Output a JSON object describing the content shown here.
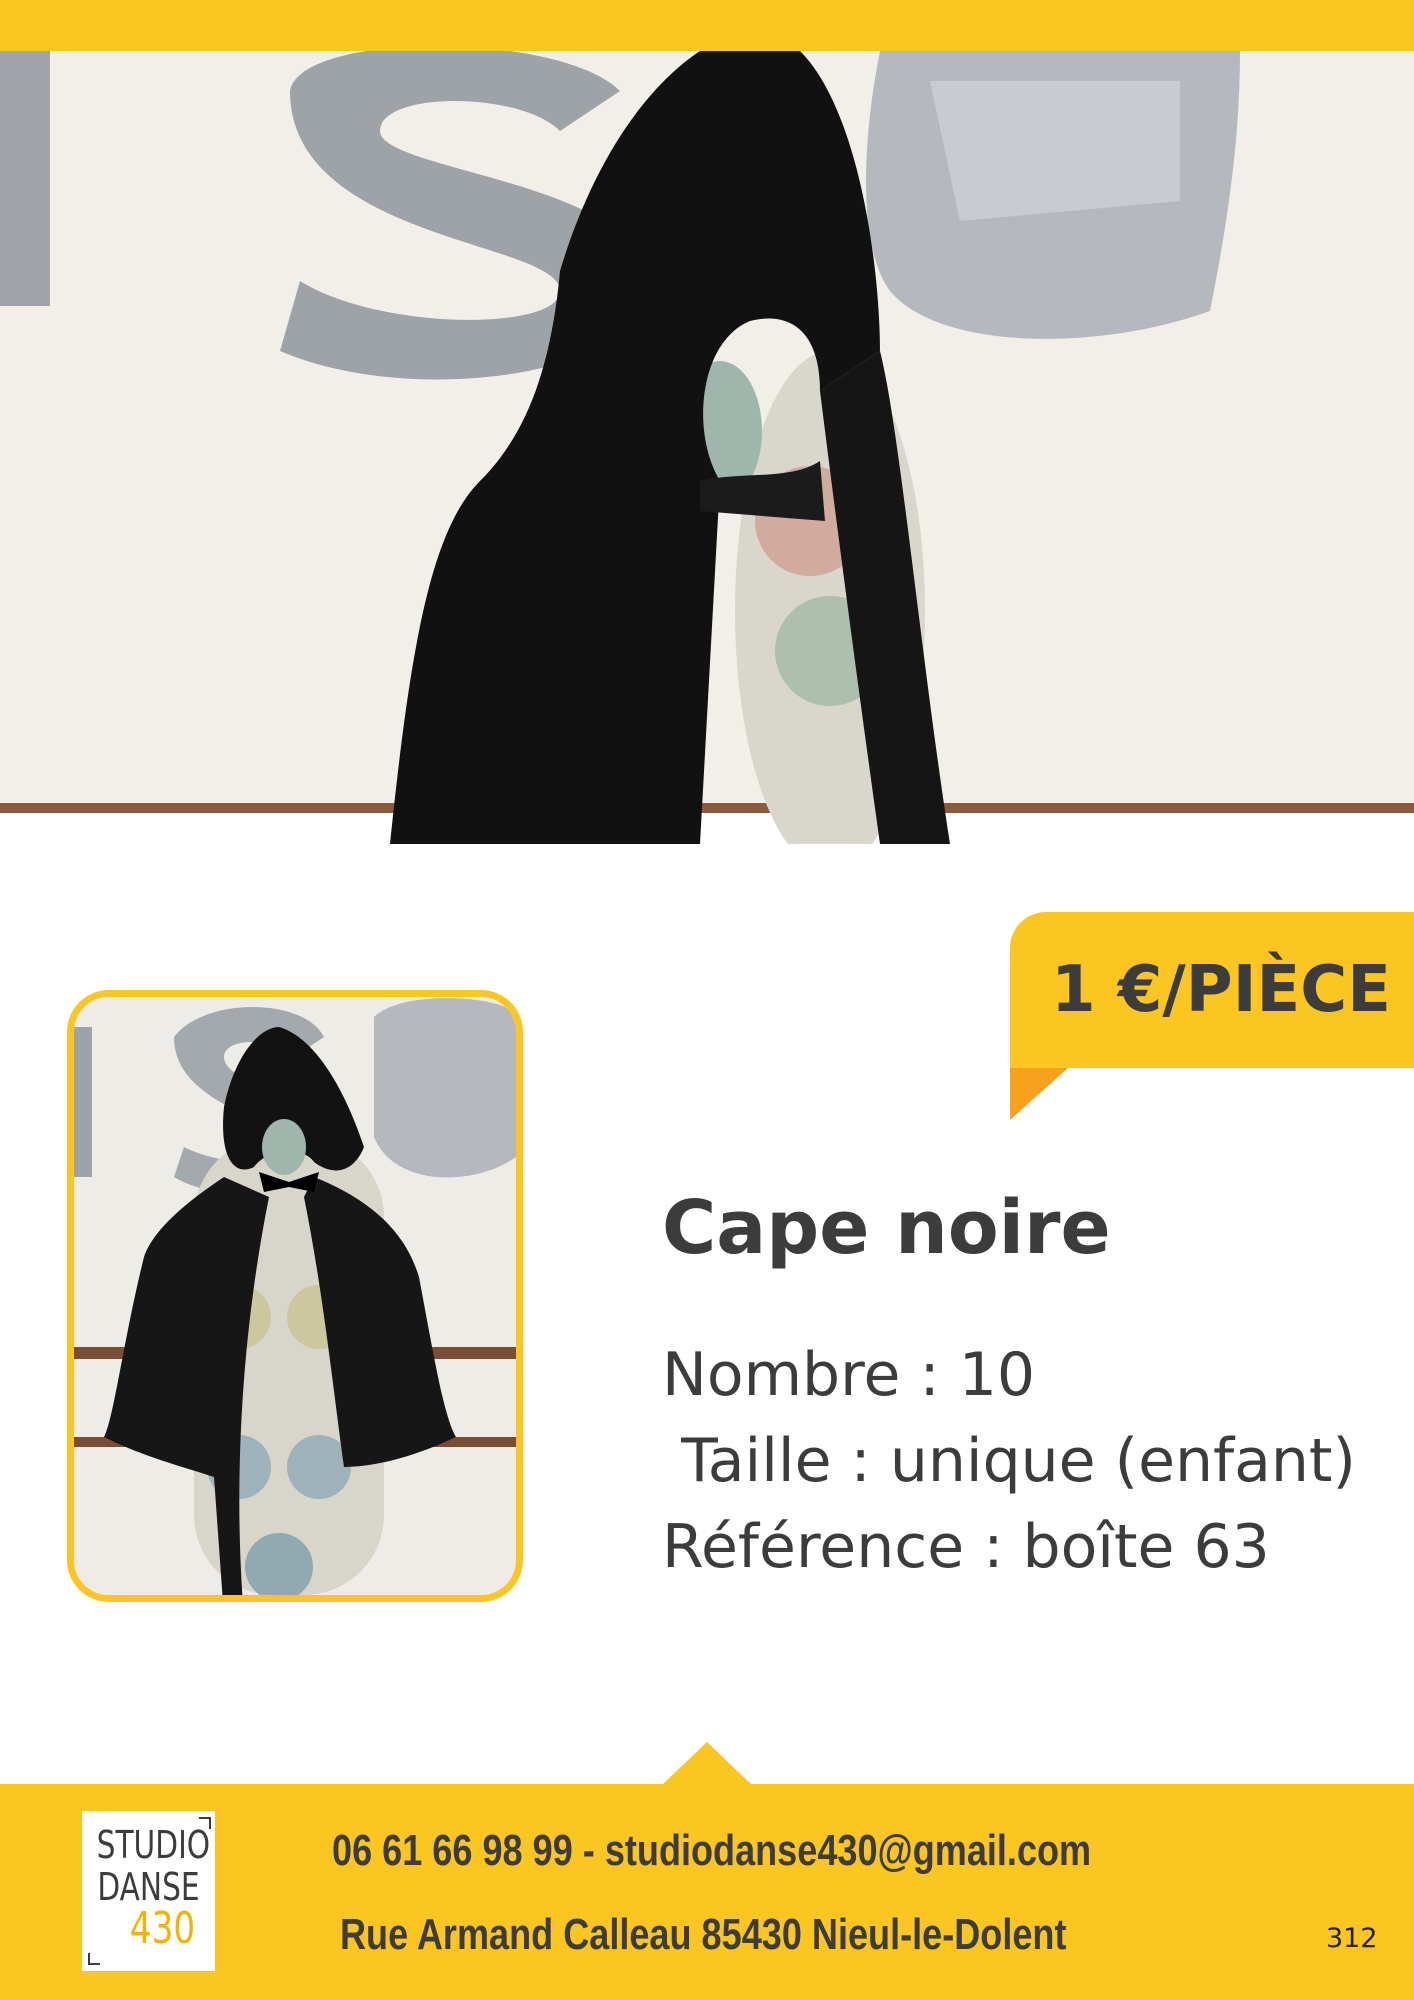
{
  "price": {
    "label": "1 €/PIÈCE"
  },
  "product": {
    "title": "Cape noire",
    "count": "Nombre : 10",
    "size": " Taille : unique (enfant)",
    "reference": "Référence : boîte 63"
  },
  "footer": {
    "logo_line1": "STUDIO",
    "logo_line2": "DANSE",
    "logo_line3": "430",
    "contact": "06 61 66 98 99 - studiodanse430@gmail.com",
    "address": "Rue Armand Calleau 85430 Nieul-le-Dolent",
    "page_number": "312"
  },
  "images": {
    "hero": "hooded-black-cape-on-mannequin-closeup",
    "thumbnail": "hooded-black-cape-on-mannequin-full"
  },
  "colors": {
    "accent": "#fbc522",
    "accent_dark": "#f7a11c",
    "text": "#3c3c3c"
  }
}
